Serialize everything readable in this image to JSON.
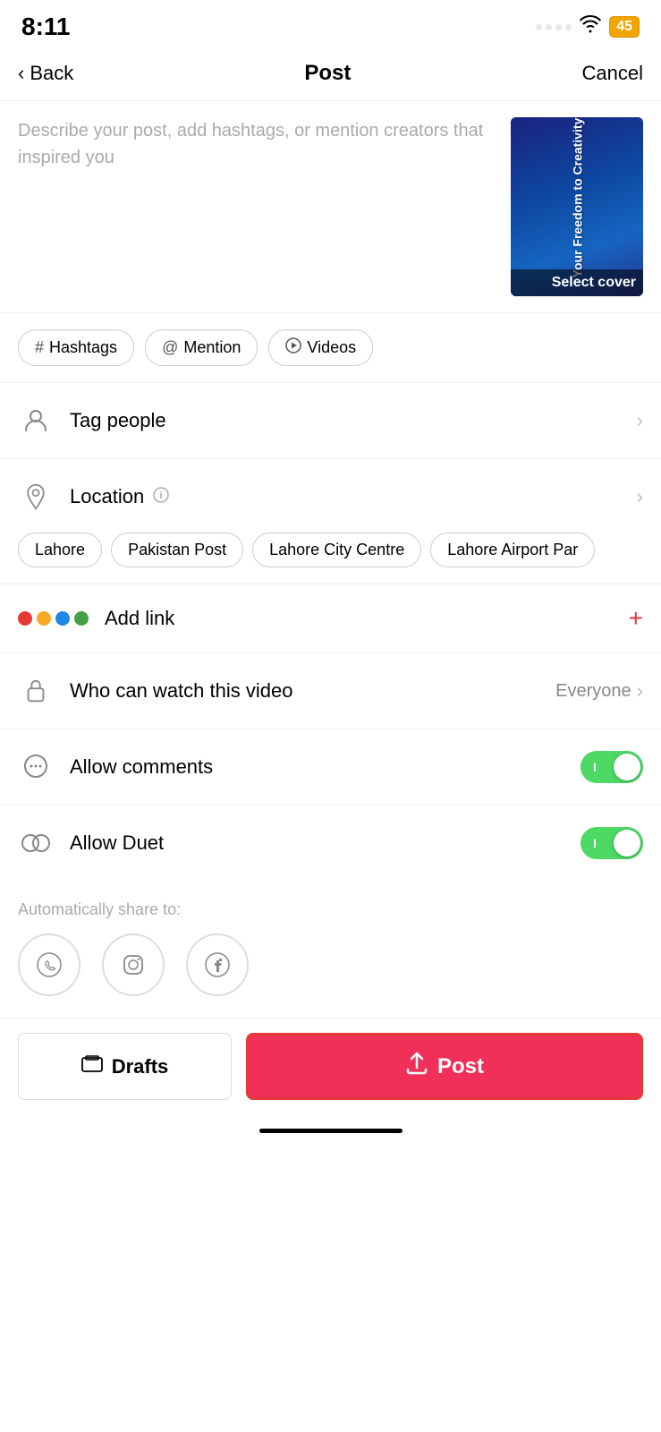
{
  "statusBar": {
    "time": "8:11",
    "battery": "45"
  },
  "header": {
    "backLabel": "Back",
    "title": "Post",
    "cancelLabel": "Cancel"
  },
  "description": {
    "placeholder": "Describe your post, add hashtags, or mention creators that inspired you"
  },
  "cover": {
    "bookTitle": "Your Freedom to Creativity",
    "label": "Select cover"
  },
  "tagButtons": [
    {
      "icon": "#",
      "label": "Hashtags"
    },
    {
      "icon": "@",
      "label": "Mention"
    },
    {
      "icon": "▶",
      "label": "Videos"
    }
  ],
  "tagPeople": {
    "label": "Tag people"
  },
  "location": {
    "label": "Location"
  },
  "locationChips": [
    "Lahore",
    "Pakistan Post",
    "Lahore City Centre",
    "Lahore Airport Par"
  ],
  "addLink": {
    "label": "Add link"
  },
  "whoCanWatch": {
    "label": "Who can watch this video",
    "value": "Everyone"
  },
  "allowComments": {
    "label": "Allow comments",
    "enabled": true
  },
  "allowDuet": {
    "label": "Allow Duet",
    "enabled": true
  },
  "shareSection": {
    "title": "Automatically share to:"
  },
  "bottomBar": {
    "draftsLabel": "Drafts",
    "postLabel": "Post"
  }
}
